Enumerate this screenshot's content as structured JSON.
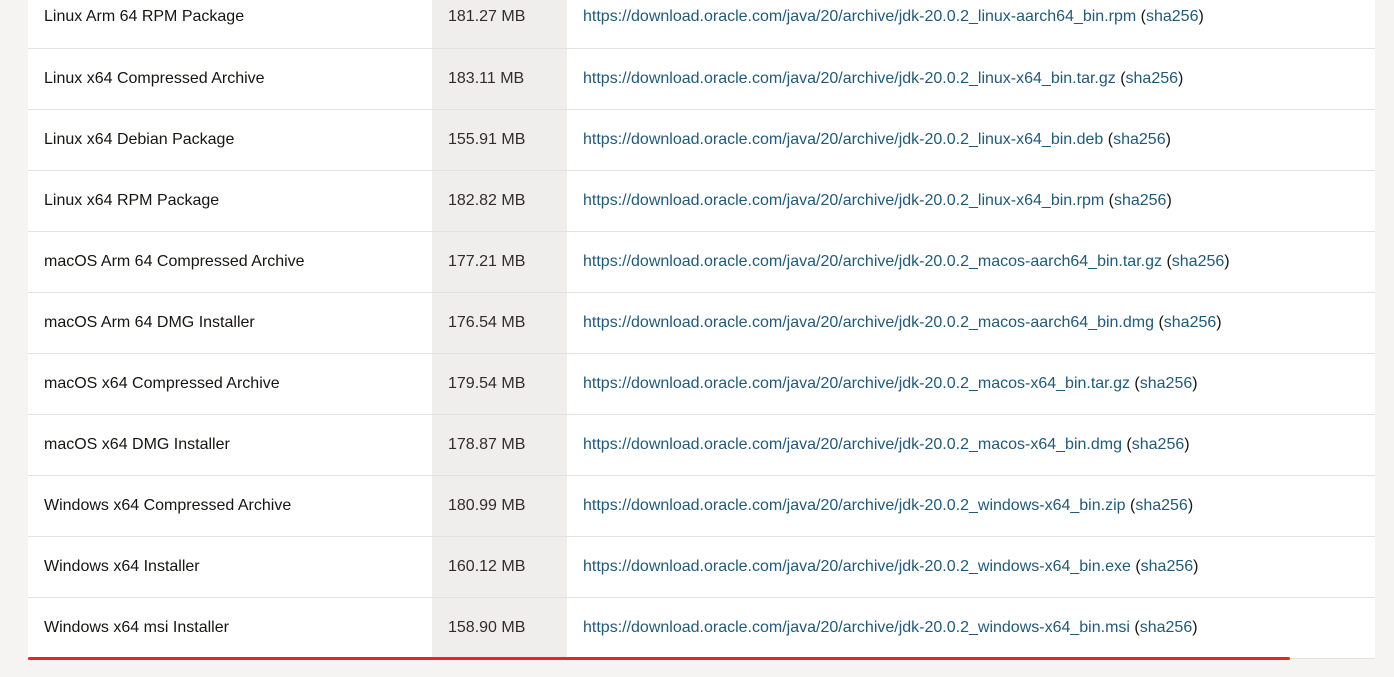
{
  "downloads": {
    "rows": [
      {
        "product": "Linux Arm 64 RPM Package",
        "size": "181.27 MB",
        "url": "https://download.oracle.com/java/20/archive/jdk-20.0.2_linux-aarch64_bin.rpm",
        "checksum": "sha256"
      },
      {
        "product": "Linux x64 Compressed Archive",
        "size": "183.11 MB",
        "url": "https://download.oracle.com/java/20/archive/jdk-20.0.2_linux-x64_bin.tar.gz",
        "checksum": "sha256"
      },
      {
        "product": "Linux x64 Debian Package",
        "size": "155.91 MB",
        "url": "https://download.oracle.com/java/20/archive/jdk-20.0.2_linux-x64_bin.deb",
        "checksum": "sha256"
      },
      {
        "product": "Linux x64 RPM Package",
        "size": "182.82 MB",
        "url": "https://download.oracle.com/java/20/archive/jdk-20.0.2_linux-x64_bin.rpm",
        "checksum": "sha256"
      },
      {
        "product": "macOS Arm 64 Compressed Archive",
        "size": "177.21 MB",
        "url": "https://download.oracle.com/java/20/archive/jdk-20.0.2_macos-aarch64_bin.tar.gz",
        "checksum": "sha256"
      },
      {
        "product": "macOS Arm 64 DMG Installer",
        "size": "176.54 MB",
        "url": "https://download.oracle.com/java/20/archive/jdk-20.0.2_macos-aarch64_bin.dmg",
        "checksum": "sha256"
      },
      {
        "product": "macOS x64 Compressed Archive",
        "size": "179.54 MB",
        "url": "https://download.oracle.com/java/20/archive/jdk-20.0.2_macos-x64_bin.tar.gz",
        "checksum": "sha256"
      },
      {
        "product": "macOS x64 DMG Installer",
        "size": "178.87 MB",
        "url": "https://download.oracle.com/java/20/archive/jdk-20.0.2_macos-x64_bin.dmg",
        "checksum": "sha256"
      },
      {
        "product": "Windows x64 Compressed Archive",
        "size": "180.99 MB",
        "url": "https://download.oracle.com/java/20/archive/jdk-20.0.2_windows-x64_bin.zip",
        "checksum": "sha256"
      },
      {
        "product": "Windows x64 Installer",
        "size": "160.12 MB",
        "url": "https://download.oracle.com/java/20/archive/jdk-20.0.2_windows-x64_bin.exe",
        "checksum": "sha256"
      },
      {
        "product": "Windows x64 msi Installer",
        "size": "158.90 MB",
        "url": "https://download.oracle.com/java/20/archive/jdk-20.0.2_windows-x64_bin.msi",
        "checksum": "sha256"
      }
    ]
  },
  "colors": {
    "link": "#1f5a7a",
    "size_column_bg": "#efeeec",
    "annotation_underline": "#e5252a"
  }
}
